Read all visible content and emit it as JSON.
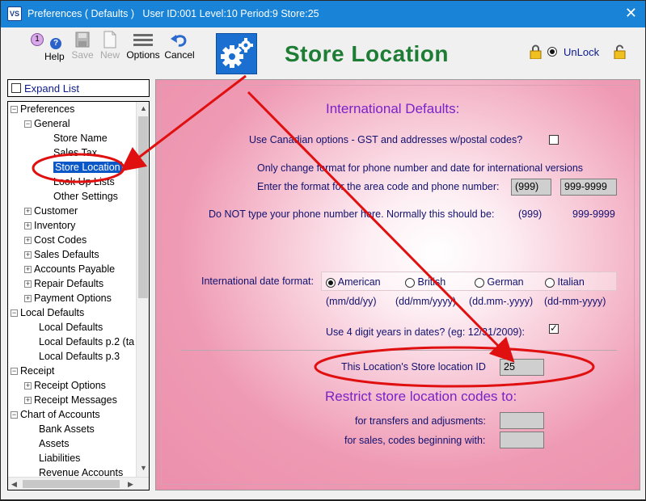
{
  "window": {
    "title": "Preferences ( Defaults )   User ID:001 Level:10 Period:9 Store:25",
    "close_label": "✕"
  },
  "toolbar": {
    "help_number": "1",
    "help_label": "Help",
    "save_label": "Save",
    "new_label": "New",
    "options_label": "Options",
    "cancel_label": "Cancel"
  },
  "page": {
    "heading": "Store Location"
  },
  "lock": {
    "unlock_label": "UnLock"
  },
  "sidebar": {
    "expand_label": "Expand List",
    "tree": [
      {
        "label": "Preferences",
        "expander": "−"
      },
      {
        "label": "General",
        "expander": "−"
      },
      {
        "label": "Store Name",
        "expander": ""
      },
      {
        "label": "Sales Tax",
        "expander": ""
      },
      {
        "label": "Store Location",
        "expander": ""
      },
      {
        "label": "Look Up Lists",
        "expander": ""
      },
      {
        "label": "Other Settings",
        "expander": ""
      },
      {
        "label": "Customer",
        "expander": "+"
      },
      {
        "label": "Inventory",
        "expander": "+"
      },
      {
        "label": "Cost Codes",
        "expander": "+"
      },
      {
        "label": "Sales Defaults",
        "expander": "+"
      },
      {
        "label": "Accounts Payable",
        "expander": "+"
      },
      {
        "label": "Repair Defaults",
        "expander": "+"
      },
      {
        "label": "Payment Options",
        "expander": "+"
      },
      {
        "label": "Local Defaults",
        "expander": "−"
      },
      {
        "label": "Local Defaults",
        "expander": ""
      },
      {
        "label": "Local Defaults p.2 (ta",
        "expander": ""
      },
      {
        "label": "Local Defaults p.3",
        "expander": ""
      },
      {
        "label": "Receipt",
        "expander": "−"
      },
      {
        "label": "Receipt Options",
        "expander": "+"
      },
      {
        "label": "Receipt Messages",
        "expander": "+"
      },
      {
        "label": "Chart of Accounts",
        "expander": "−"
      },
      {
        "label": "Bank Assets",
        "expander": ""
      },
      {
        "label": "Assets",
        "expander": ""
      },
      {
        "label": "Liabilities",
        "expander": ""
      },
      {
        "label": "Revenue Accounts",
        "expander": ""
      }
    ]
  },
  "form": {
    "intl_heading": "International Defaults:",
    "canadian_label": "Use Canadian options - GST and addresses w/postal codes?",
    "phone_note": "Only change format for phone number and date for international versions",
    "phone_format_label": "Enter the format for the area code and phone number:",
    "area_code_format": "(999)",
    "phone_format": "999-9999",
    "phone_warning": "Do NOT type your phone number here. Normally this should be:",
    "example_area": "(999)",
    "example_phone": "999-9999",
    "date_format_label": "International date format:",
    "date_options": [
      {
        "label": "American",
        "format": "(mm/dd/yy)"
      },
      {
        "label": "British",
        "format": "(dd/mm/yyyy)"
      },
      {
        "label": "German",
        "format": "(dd.mm-.yyyy)"
      },
      {
        "label": "Italian",
        "format": "(dd-mm-yyyy)"
      }
    ],
    "four_digit_label": "Use 4 digit years in dates? (eg: 12/31/2009):",
    "store_location_id_label": "This Location's Store location ID",
    "store_location_id_value": "25",
    "restrict_heading": "Restrict store location codes to:",
    "transfers_label": "for transfers and adjusments:",
    "transfers_value": "",
    "sales_codes_label": "for sales, codes beginning with:",
    "sales_codes_value": ""
  },
  "colors": {
    "title_bar": "#1883d7",
    "heading_green": "#1d7d34",
    "purple_heading": "#7a22c8",
    "annotation_red": "#e01010",
    "selection_blue": "#0a58c8"
  }
}
